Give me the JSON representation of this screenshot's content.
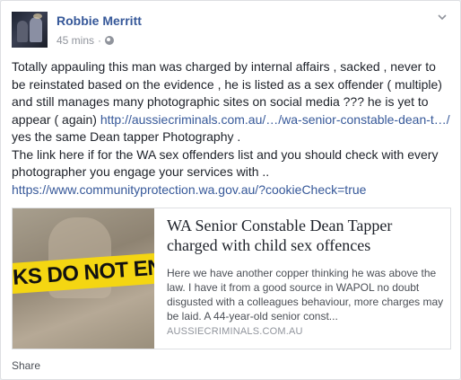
{
  "post": {
    "author": "Robbie Merritt",
    "time": "45 mins",
    "separator": "·",
    "text_part1": "Totally appauling this man was charged by internal affairs , sacked , never to be reinstated based on the evidence , he is listed as a sex offender ( multiple) and still manages many photographic sites on social media ??? he is yet to appear ( again) ",
    "link1": "http://aussiecriminals.com.au/…/wa-senior-constable-dean-t…/",
    "text_part2": " yes the same Dean tapper Photography .",
    "text_part3": "The link here if for the WA sex offenders list and you should check with every photographer you engage your services with ..",
    "link2": "https://www.communityprotection.wa.gov.au/?cookieCheck=true"
  },
  "card": {
    "image_text": "KS DO NOT ENTE",
    "title": "WA Senior Constable Dean Tapper charged with child sex offences",
    "description": "Here we have another copper thinking he was above the law. I have it from a good source in WAPOL no doubt disgusted with a colleagues behaviour, more charges may be laid. A 44-year-old senior const...",
    "domain": "AUSSIECRIMINALS.COM.AU"
  },
  "actions": {
    "share": "Share"
  },
  "icons": {
    "globe": "globe-icon",
    "menu": "chevron-down-icon"
  },
  "colors": {
    "link": "#365899",
    "meta": "#90949c",
    "tape": "#f4d612"
  }
}
